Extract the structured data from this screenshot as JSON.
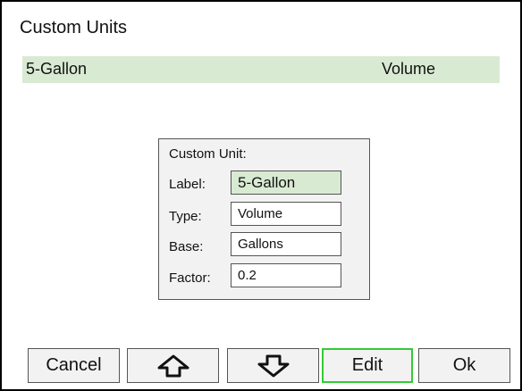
{
  "screen": {
    "title": "Custom Units"
  },
  "list": {
    "items": [
      {
        "name": "5-Gallon",
        "type": "Volume"
      }
    ]
  },
  "dialog": {
    "title": "Custom Unit:",
    "fields": [
      {
        "label": "Label:",
        "value": "5-Gallon"
      },
      {
        "label": "Type:",
        "value": "Volume"
      },
      {
        "label": "Base:",
        "value": "Gallons"
      },
      {
        "label": "Factor:",
        "value": "0.2"
      }
    ]
  },
  "buttons": {
    "cancel": "Cancel",
    "up_icon": "arrow-up-icon",
    "down_icon": "arrow-down-icon",
    "edit": "Edit",
    "ok": "Ok"
  },
  "colors": {
    "selection": "#d9ead3",
    "active_outline": "#33cc33",
    "panel": "#f2f2f2",
    "border": "#555555"
  }
}
